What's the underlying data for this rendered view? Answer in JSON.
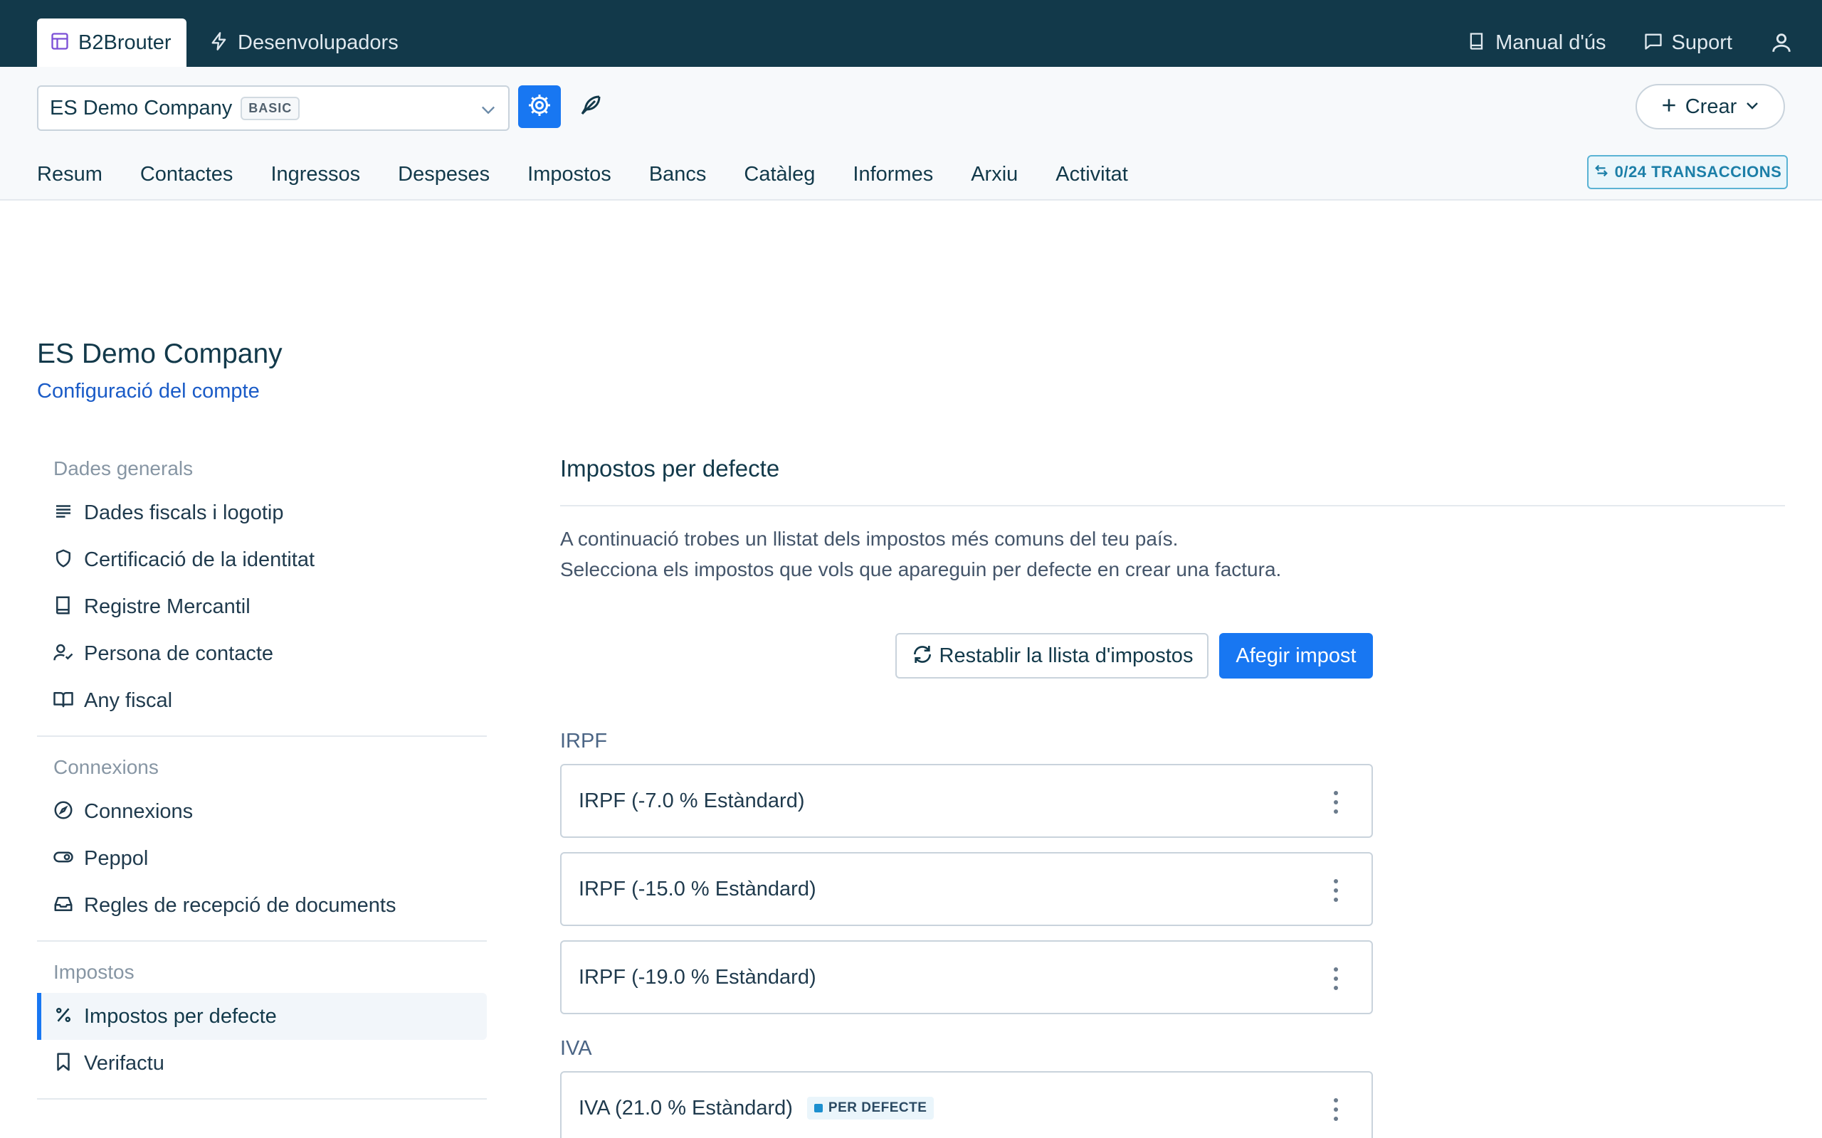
{
  "topbar": {
    "brand": "B2Brouter",
    "developers": "Desenvolupadors",
    "manual": "Manual d'ús",
    "support": "Suport"
  },
  "company": {
    "name": "ES Demo Company",
    "plan": "BASIC"
  },
  "create_label": "Crear",
  "nav": [
    "Resum",
    "Contactes",
    "Ingressos",
    "Despeses",
    "Impostos",
    "Bancs",
    "Catàleg",
    "Informes",
    "Arxiu",
    "Activitat"
  ],
  "transactions": "0/24 TRANSACCIONS",
  "page": {
    "title": "ES Demo Company",
    "subtitle": "Configuració del compte"
  },
  "sidebar": {
    "general_title": "Dades generals",
    "general": [
      "Dades fiscals i logotip",
      "Certificació de la identitat",
      "Registre Mercantil",
      "Persona de contacte",
      "Any fiscal"
    ],
    "connections_title": "Connexions",
    "connections": [
      "Connexions",
      "Peppol",
      "Regles de recepció de documents"
    ],
    "taxes_title": "Impostos",
    "taxes": [
      "Impostos per defecte",
      "Verifactu"
    ]
  },
  "main": {
    "title": "Impostos per defecte",
    "desc_line1": "A continuació trobes un llistat dels impostos més comuns del teu país.",
    "desc_line2": "Selecciona els impostos que vols que apareguin per defecte en crear una factura.",
    "reset_label": "Restablir la llista d'impostos",
    "add_label": "Afegir impost",
    "irpf_label": "IRPF",
    "irpf": [
      "IRPF (-7.0 % Estàndard)",
      "IRPF (-15.0 % Estàndard)",
      "IRPF (-19.0 % Estàndard)"
    ],
    "iva_label": "IVA",
    "iva": [
      "IVA (21.0 % Estàndard)"
    ],
    "default_badge": "PER DEFECTE"
  },
  "colors": {
    "topbar": "#12394a",
    "accent": "#1877f2",
    "link": "#1a5bc7"
  }
}
